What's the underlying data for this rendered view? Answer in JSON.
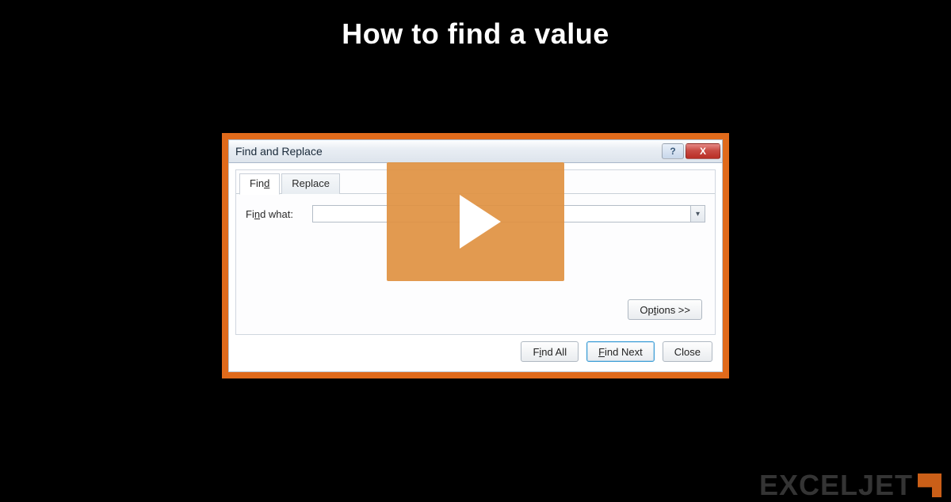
{
  "page": {
    "title": "How to find a value"
  },
  "dialog": {
    "title": "Find and Replace",
    "help_icon": "?",
    "close_icon": "X",
    "tabs": {
      "find": "Find",
      "replace": "Replace"
    },
    "find_label": "Find what:",
    "find_value": "",
    "options_label": "Options >>",
    "buttons": {
      "find_all": "Find All",
      "find_next": "Find Next",
      "close": "Close"
    }
  },
  "watermark": {
    "text": "EXCELJET"
  }
}
